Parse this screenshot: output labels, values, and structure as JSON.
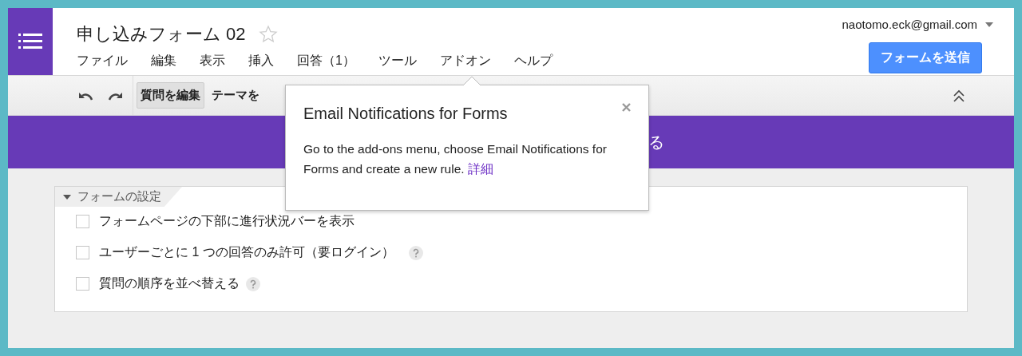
{
  "header": {
    "title": "申し込みフォーム 02",
    "starred": false,
    "account": "naotomo.eck@gmail.com",
    "send_button": "フォームを送信"
  },
  "menu": [
    "ファイル",
    "編集",
    "表示",
    "挿入",
    "回答（1）",
    "ツール",
    "アドオン",
    "ヘルプ"
  ],
  "toolbar": {
    "tabs": [
      {
        "label": "質問を編集",
        "selected": true
      },
      {
        "label": "テーマを",
        "selected": false
      }
    ]
  },
  "banner": {
    "text": "る"
  },
  "popup": {
    "title": "Email Notifications for Forms",
    "body": "Go to the add-ons menu, choose Email Notifications for Forms and create a new rule.",
    "link": "詳細"
  },
  "settings": {
    "title": "フォームの設定",
    "expanded": true,
    "options": [
      {
        "label": "フォームページの下部に進行状況バーを表示",
        "checked": false,
        "help": false
      },
      {
        "label": "ユーザーごとに 1 つの回答のみ許可（要ログイン）",
        "checked": false,
        "help": true
      },
      {
        "label": "質問の順序を並べ替える",
        "checked": false,
        "help": true
      }
    ]
  }
}
